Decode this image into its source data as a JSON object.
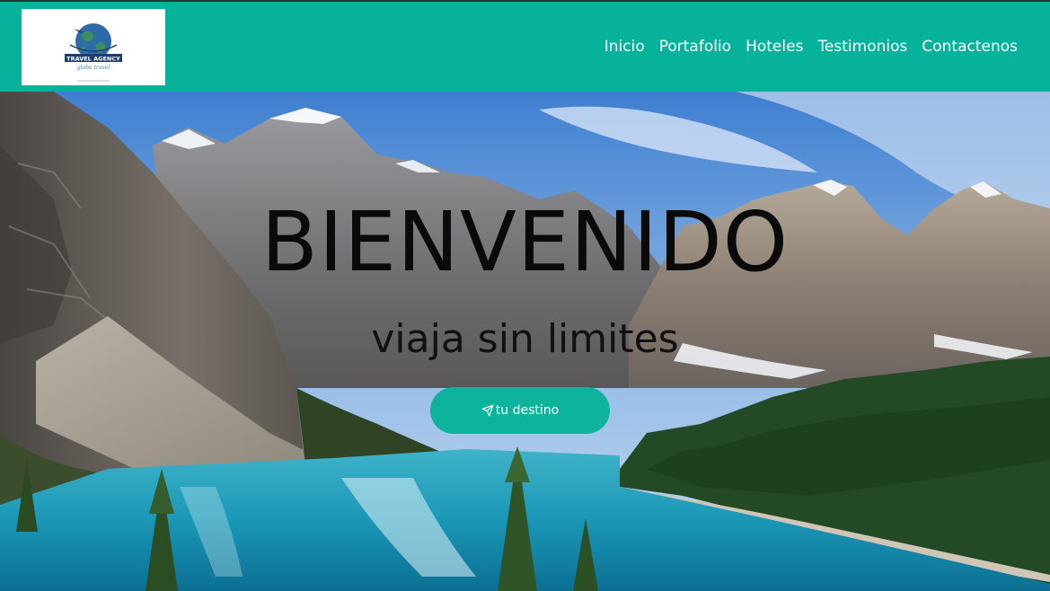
{
  "brand": {
    "logo_icon": "globe-airplane-icon",
    "logo_text": "TRAVEL AGENCY",
    "logo_tagline": "globe travel"
  },
  "nav": {
    "items": [
      {
        "label": "Inicio"
      },
      {
        "label": "Portafolio"
      },
      {
        "label": "Hoteles"
      },
      {
        "label": "Testimonios"
      },
      {
        "label": "Contactenos"
      }
    ]
  },
  "hero": {
    "title": "BIENVENIDO",
    "subtitle": "viaja sin limites",
    "cta_label": "tu destino",
    "cta_icon": "send-icon",
    "background": "mountain-lake-photo"
  },
  "colors": {
    "navbar": "#06b39a",
    "button": "#0db49b",
    "nav_text": "#ffffff",
    "title_text": "#0a0a0a"
  }
}
